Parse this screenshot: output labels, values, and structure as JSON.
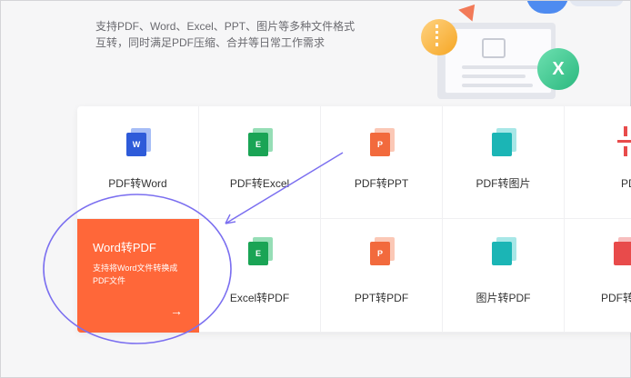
{
  "intro": {
    "line1": "支持PDF、Word、Excel、PPT、图片等多种文件格式",
    "line2": "互转，同时满足PDF压缩、合并等日常工作需求"
  },
  "hero": {
    "badge_letter": "X"
  },
  "tools": {
    "row1": [
      {
        "label": "PDF转Word",
        "icon_letter": "W",
        "icon": "word-icon"
      },
      {
        "label": "PDF转Excel",
        "icon_letter": "E",
        "icon": "excel-icon"
      },
      {
        "label": "PDF转PPT",
        "icon_letter": "P",
        "icon": "ppt-icon"
      },
      {
        "label": "PDF转图片",
        "icon_letter": "",
        "icon": "image-icon"
      },
      {
        "label": "PDF压",
        "icon_letter": "",
        "icon": "compress-icon"
      }
    ],
    "featured": {
      "title": "Word转PDF",
      "description": "支持将Word文件转换成PDF文件",
      "arrow": "→"
    },
    "row2": [
      {
        "label": "Excel转PDF",
        "icon_letter": "E",
        "icon": "excel-icon"
      },
      {
        "label": "PPT转PDF",
        "icon_letter": "P",
        "icon": "ppt-icon"
      },
      {
        "label": "图片转PDF",
        "icon_letter": "",
        "icon": "image-icon"
      },
      {
        "label": "PDF转",
        "icon_letter": "",
        "icon": "pdf-icon"
      }
    ]
  },
  "colors": {
    "featured_bg": "#ff6739",
    "annotation": "#7b6ff0"
  }
}
